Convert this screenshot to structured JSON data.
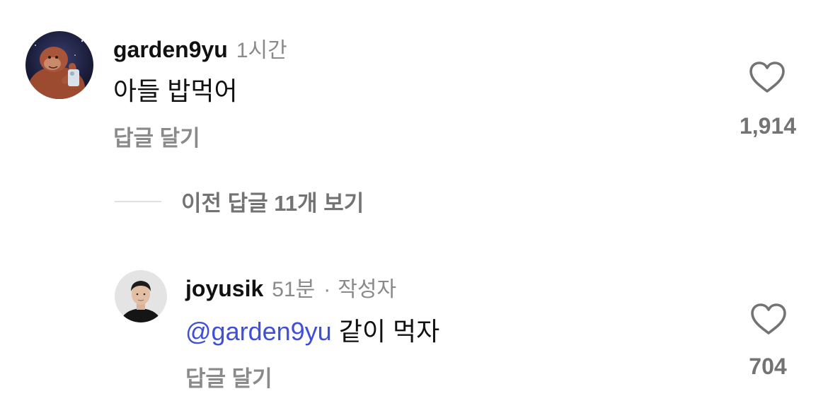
{
  "comments": [
    {
      "username": "garden9yu",
      "time": "1시간",
      "text": "아들 밥먹어",
      "reply_label": "답글 달기",
      "likes": "1,914",
      "avatar": "orangutan-avatar"
    }
  ],
  "view_more": {
    "label": "이전 답글 11개 보기"
  },
  "replies": [
    {
      "username": "joyusik",
      "time": "51분",
      "separator": "·",
      "author_badge": "작성자",
      "mention": "@garden9yu",
      "text": "같이 먹자",
      "reply_label": "답글 달기",
      "likes": "704",
      "avatar": "person-avatar"
    }
  ],
  "colors": {
    "mention": "#3f4fd8",
    "secondary_text": "#8a8a8a",
    "like_count": "#737373"
  }
}
